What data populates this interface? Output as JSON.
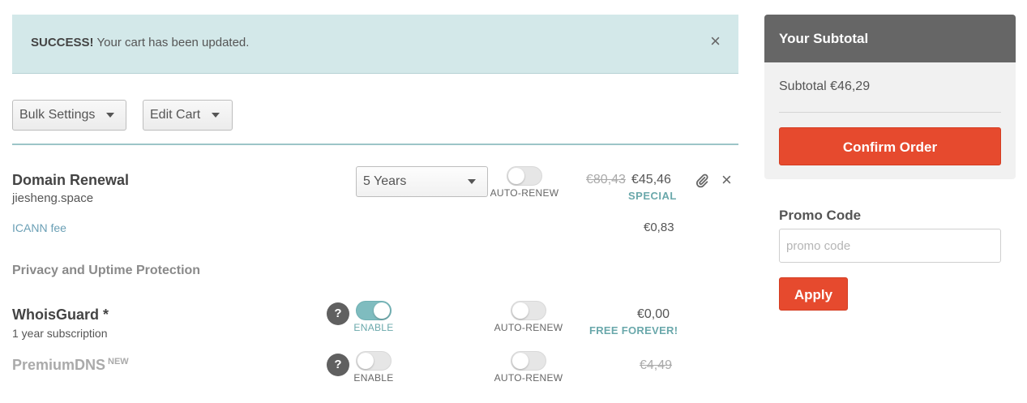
{
  "alert": {
    "strong": "SUCCESS!",
    "message": "Your cart has been updated.",
    "close_icon": "×"
  },
  "toolbar": {
    "bulk_settings_label": "Bulk Settings",
    "edit_cart_label": "Edit Cart"
  },
  "domain_item": {
    "title": "Domain Renewal",
    "domain": "jiesheng.space",
    "period_selected": "5 Years",
    "auto_renew_label": "AUTO-RENEW",
    "auto_renew_on": false,
    "old_price": "€80,43",
    "price": "€45,46",
    "price_tag": "SPECIAL",
    "icann_label": "ICANN fee",
    "icann_price": "€0,83"
  },
  "privacy_section": {
    "title": "Privacy and Uptime Protection",
    "whoisguard": {
      "title": "WhoisGuard *",
      "subtitle": "1 year subscription",
      "help": "?",
      "enable_label": "ENABLE",
      "enabled": true,
      "auto_renew_label": "AUTO-RENEW",
      "auto_renew_on": false,
      "price": "€0,00",
      "price_tag": "FREE FOREVER!"
    },
    "premiumdns": {
      "title": "PremiumDNS",
      "badge": "NEW",
      "help": "?",
      "enable_label": "ENABLE",
      "enabled": false,
      "auto_renew_label": "AUTO-RENEW",
      "auto_renew_on": false,
      "price": "€4,49"
    }
  },
  "sidebar": {
    "title": "Your Subtotal",
    "subtotal_line": "Subtotal €46,29",
    "confirm_label": "Confirm Order",
    "promo_title": "Promo Code",
    "promo_placeholder": "promo code",
    "apply_label": "Apply"
  },
  "colors": {
    "accent": "#e64a2e",
    "teal": "#7fbcbf",
    "alert_bg": "#d3e8e9"
  },
  "icons": {
    "attach": "paperclip-icon",
    "remove": "close-icon",
    "dropdown": "caret-down-icon"
  }
}
